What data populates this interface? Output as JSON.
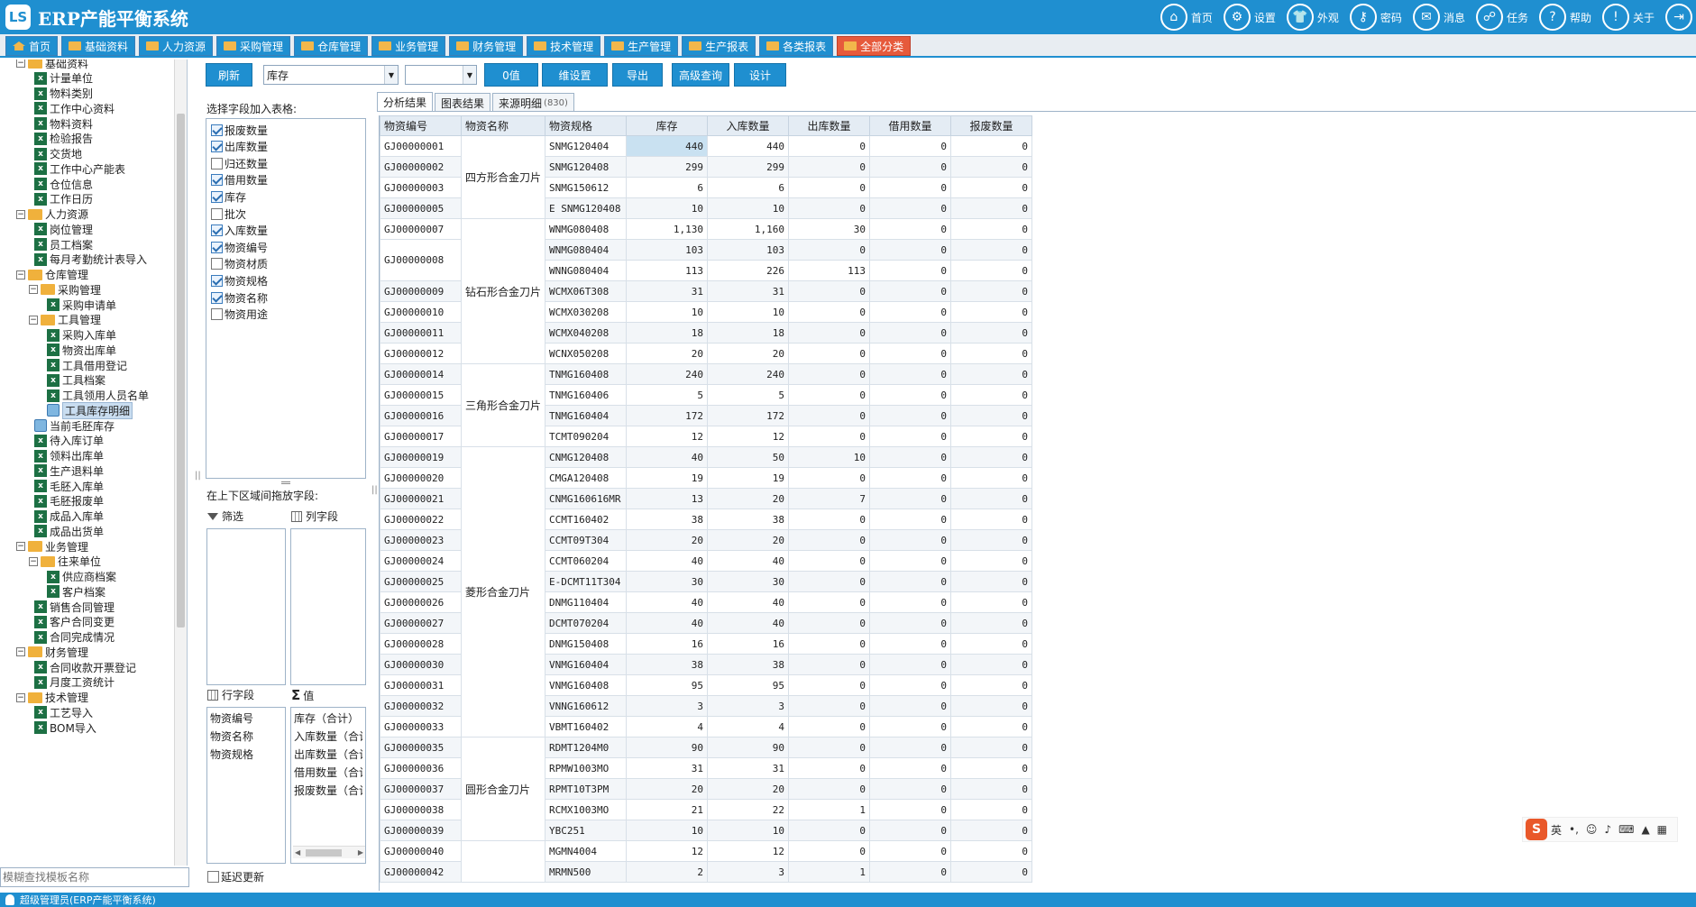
{
  "header": {
    "logo_text": "LS",
    "title": "ERP产能平衡系统",
    "nav": [
      {
        "icon": "home-icon",
        "glyph": "⌂",
        "label": "首页"
      },
      {
        "icon": "gear-icon",
        "glyph": "⚙",
        "label": "设置"
      },
      {
        "icon": "shirt-icon",
        "glyph": "👕",
        "label": "外观"
      },
      {
        "icon": "key-icon",
        "glyph": "⚷",
        "label": "密码"
      },
      {
        "icon": "mail-icon",
        "glyph": "✉",
        "label": "消息"
      },
      {
        "icon": "task-icon",
        "glyph": "☍",
        "label": "任务"
      },
      {
        "icon": "help-icon",
        "glyph": "?",
        "label": "帮助"
      },
      {
        "icon": "about-icon",
        "glyph": "!",
        "label": "关于"
      },
      {
        "icon": "exit-icon",
        "glyph": "⇥",
        "label": ""
      }
    ]
  },
  "tabs": [
    "首页",
    "基础资料",
    "人力资源",
    "采购管理",
    "仓库管理",
    "业务管理",
    "财务管理",
    "技术管理",
    "生产管理",
    "生产报表",
    "各类报表",
    "全部分类"
  ],
  "tree": {
    "search_placeholder": "模糊查找模板名称",
    "items": [
      {
        "label": "基础资料",
        "type": "folder",
        "level": 0,
        "toggle": "⊟"
      },
      {
        "label": "计量单位",
        "type": "xls",
        "level": 1
      },
      {
        "label": "物料类别",
        "type": "xls",
        "level": 1
      },
      {
        "label": "工作中心资料",
        "type": "xls",
        "level": 1
      },
      {
        "label": "物料资料",
        "type": "xls",
        "level": 1
      },
      {
        "label": "检验报告",
        "type": "xls",
        "level": 1
      },
      {
        "label": "交货地",
        "type": "xls",
        "level": 1
      },
      {
        "label": "工作中心产能表",
        "type": "xls",
        "level": 1
      },
      {
        "label": "仓位信息",
        "type": "xls",
        "level": 1
      },
      {
        "label": "工作日历",
        "type": "xls",
        "level": 1
      },
      {
        "label": "人力资源",
        "type": "folder",
        "level": 0,
        "toggle": "⊟"
      },
      {
        "label": "岗位管理",
        "type": "xls",
        "level": 1
      },
      {
        "label": "员工档案",
        "type": "xls",
        "level": 1
      },
      {
        "label": "每月考勤统计表导入",
        "type": "xls",
        "level": 1
      },
      {
        "label": "仓库管理",
        "type": "folder",
        "level": 0,
        "toggle": "⊟"
      },
      {
        "label": "采购管理",
        "type": "folder",
        "level": 1,
        "toggle": "⊟"
      },
      {
        "label": "采购申请单",
        "type": "xls",
        "level": 2
      },
      {
        "label": "工具管理",
        "type": "folder",
        "level": 1,
        "toggle": "⊟"
      },
      {
        "label": "采购入库单",
        "type": "xls",
        "level": 2
      },
      {
        "label": "物资出库单",
        "type": "xls",
        "level": 2
      },
      {
        "label": "工具借用登记",
        "type": "xls",
        "level": 2
      },
      {
        "label": "工具档案",
        "type": "xls",
        "level": 2
      },
      {
        "label": "工具领用人员名单",
        "type": "xls",
        "level": 2
      },
      {
        "label": "工具库存明细",
        "type": "pic",
        "level": 2,
        "selected": true
      },
      {
        "label": "当前毛胚库存",
        "type": "pic",
        "level": 1
      },
      {
        "label": "待入库订单",
        "type": "xls",
        "level": 1
      },
      {
        "label": "领料出库单",
        "type": "xls",
        "level": 1
      },
      {
        "label": "生产退料单",
        "type": "xls",
        "level": 1
      },
      {
        "label": "毛胚入库单",
        "type": "xls",
        "level": 1
      },
      {
        "label": "毛胚报废单",
        "type": "xls",
        "level": 1
      },
      {
        "label": "成品入库单",
        "type": "xls",
        "level": 1
      },
      {
        "label": "成品出货单",
        "type": "xls",
        "level": 1
      },
      {
        "label": "业务管理",
        "type": "folder",
        "level": 0,
        "toggle": "⊟"
      },
      {
        "label": "往来单位",
        "type": "folder",
        "level": 1,
        "toggle": "⊟"
      },
      {
        "label": "供应商档案",
        "type": "xls",
        "level": 2
      },
      {
        "label": "客户档案",
        "type": "xls",
        "level": 2
      },
      {
        "label": "销售合同管理",
        "type": "xls",
        "level": 1
      },
      {
        "label": "客户合同变更",
        "type": "xls",
        "level": 1
      },
      {
        "label": "合同完成情况",
        "type": "xls",
        "level": 1
      },
      {
        "label": "财务管理",
        "type": "folder",
        "level": 0,
        "toggle": "⊟"
      },
      {
        "label": "合同收款开票登记",
        "type": "xls",
        "level": 1
      },
      {
        "label": "月度工资统计",
        "type": "xls",
        "level": 1
      },
      {
        "label": "技术管理",
        "type": "folder",
        "level": 0,
        "toggle": "⊟"
      },
      {
        "label": "工艺导入",
        "type": "xls",
        "level": 1
      },
      {
        "label": "BOM导入",
        "type": "xls",
        "level": 1
      }
    ]
  },
  "toolbar": {
    "refresh": "刷新",
    "source_select": "库存",
    "second_select": "",
    "zero_value": "0值",
    "dim_settings": "维设置",
    "export": "导出",
    "advanced_query": "高级查询",
    "design": "设计"
  },
  "fields_panel": {
    "title": "选择字段加入表格:",
    "fields": [
      {
        "label": "报废数量",
        "checked": true
      },
      {
        "label": "出库数量",
        "checked": true
      },
      {
        "label": "归还数量",
        "checked": false
      },
      {
        "label": "借用数量",
        "checked": true
      },
      {
        "label": "库存",
        "checked": true
      },
      {
        "label": "批次",
        "checked": false
      },
      {
        "label": "入库数量",
        "checked": true
      },
      {
        "label": "物资编号",
        "checked": true
      },
      {
        "label": "物资材质",
        "checked": false
      },
      {
        "label": "物资规格",
        "checked": true
      },
      {
        "label": "物资名称",
        "checked": true
      },
      {
        "label": "物资用途",
        "checked": false
      }
    ],
    "drag_hint": "在上下区域间拖放字段:",
    "filter_label": "筛选",
    "column_label": "列字段",
    "row_label": "行字段",
    "value_label": "值",
    "row_fields": [
      "物资编号",
      "物资名称",
      "物资规格"
    ],
    "value_fields": [
      "库存（合计）",
      "入库数量（合计）",
      "出库数量（合计）",
      "借用数量（合计）",
      "报废数量（合计）"
    ],
    "defer_update": "延迟更新"
  },
  "result_tabs": [
    {
      "label": "分析结果",
      "count": ""
    },
    {
      "label": "图表结果",
      "count": ""
    },
    {
      "label": "来源明细",
      "count": "(830)"
    }
  ],
  "grid": {
    "columns": [
      "物资编号",
      "物资名称",
      "物资规格",
      "库存",
      "入库数量",
      "出库数量",
      "借用数量",
      "报废数量"
    ],
    "groups": [
      {
        "name": "四方形合金刀片",
        "rows": [
          [
            "GJ00000001",
            "SNMG120404",
            "440",
            "440",
            "0",
            "0",
            "0"
          ],
          [
            "GJ00000002",
            "SNMG120408",
            "299",
            "299",
            "0",
            "0",
            "0"
          ],
          [
            "GJ00000003",
            "SNMG150612",
            "6",
            "6",
            "0",
            "0",
            "0"
          ],
          [
            "GJ00000005",
            "E SNMG120408",
            "10",
            "10",
            "0",
            "0",
            "0"
          ]
        ]
      },
      {
        "name": "钻石形合金刀片",
        "rows": [
          [
            "GJ00000007",
            "WNMG080408",
            "1,130",
            "1,160",
            "30",
            "0",
            "0"
          ],
          [
            "GJ00000008",
            "WNMG080404",
            "103",
            "103",
            "0",
            "0",
            "0"
          ],
          [
            "",
            "WNNG080404",
            "113",
            "226",
            "113",
            "0",
            "0"
          ],
          [
            "GJ00000009",
            "WCMX06T308",
            "31",
            "31",
            "0",
            "0",
            "0"
          ],
          [
            "GJ00000010",
            "WCMX030208",
            "10",
            "10",
            "0",
            "0",
            "0"
          ],
          [
            "GJ00000011",
            "WCMX040208",
            "18",
            "18",
            "0",
            "0",
            "0"
          ],
          [
            "GJ00000012",
            "WCNX050208",
            "20",
            "20",
            "0",
            "0",
            "0"
          ]
        ]
      },
      {
        "name": "三角形合金刀片",
        "rows": [
          [
            "GJ00000014",
            "TNMG160408",
            "240",
            "240",
            "0",
            "0",
            "0"
          ],
          [
            "GJ00000015",
            "TNMG160406",
            "5",
            "5",
            "0",
            "0",
            "0"
          ],
          [
            "GJ00000016",
            "TNMG160404",
            "172",
            "172",
            "0",
            "0",
            "0"
          ],
          [
            "GJ00000017",
            "TCMT090204",
            "12",
            "12",
            "0",
            "0",
            "0"
          ]
        ]
      },
      {
        "name": "菱形合金刀片",
        "rows": [
          [
            "GJ00000019",
            "CNMG120408",
            "40",
            "50",
            "10",
            "0",
            "0"
          ],
          [
            "GJ00000020",
            "CMGA120408",
            "19",
            "19",
            "0",
            "0",
            "0"
          ],
          [
            "GJ00000021",
            "CNMG160616MR",
            "13",
            "20",
            "7",
            "0",
            "0"
          ],
          [
            "GJ00000022",
            "CCMT160402",
            "38",
            "38",
            "0",
            "0",
            "0"
          ],
          [
            "GJ00000023",
            "CCMT09T304",
            "20",
            "20",
            "0",
            "0",
            "0"
          ],
          [
            "GJ00000024",
            "CCMT060204",
            "40",
            "40",
            "0",
            "0",
            "0"
          ],
          [
            "GJ00000025",
            "E-DCMT11T304",
            "30",
            "30",
            "0",
            "0",
            "0"
          ],
          [
            "GJ00000026",
            "DNMG110404",
            "40",
            "40",
            "0",
            "0",
            "0"
          ],
          [
            "GJ00000027",
            "DCMT070204",
            "40",
            "40",
            "0",
            "0",
            "0"
          ],
          [
            "GJ00000028",
            "DNMG150408",
            "16",
            "16",
            "0",
            "0",
            "0"
          ],
          [
            "GJ00000030",
            "VNMG160404",
            "38",
            "38",
            "0",
            "0",
            "0"
          ],
          [
            "GJ00000031",
            "VNMG160408",
            "95",
            "95",
            "0",
            "0",
            "0"
          ],
          [
            "GJ00000032",
            "VNNG160612",
            "3",
            "3",
            "0",
            "0",
            "0"
          ],
          [
            "GJ00000033",
            "VBMT160402",
            "4",
            "4",
            "0",
            "0",
            "0"
          ]
        ]
      },
      {
        "name": "圆形合金刀片",
        "rows": [
          [
            "GJ00000035",
            "RDMT1204M0",
            "90",
            "90",
            "0",
            "0",
            "0"
          ],
          [
            "GJ00000036",
            "RPMW1003MO",
            "31",
            "31",
            "0",
            "0",
            "0"
          ],
          [
            "GJ00000037",
            "RPMT10T3PM",
            "20",
            "20",
            "0",
            "0",
            "0"
          ],
          [
            "GJ00000038",
            "RCMX1003MO",
            "21",
            "22",
            "1",
            "0",
            "0"
          ],
          [
            "GJ00000039",
            "YBC251",
            "10",
            "10",
            "0",
            "0",
            "0"
          ]
        ]
      },
      {
        "name": "",
        "rows": [
          [
            "GJ00000040",
            "MGMN4004",
            "12",
            "12",
            "0",
            "0",
            "0"
          ],
          [
            "GJ00000042",
            "MRMN500",
            "2",
            "3",
            "1",
            "0",
            "0"
          ]
        ]
      }
    ]
  },
  "ime": {
    "brand": "S",
    "mode": "英"
  },
  "status": {
    "user": "超级管理员(ERP产能平衡系统)"
  }
}
